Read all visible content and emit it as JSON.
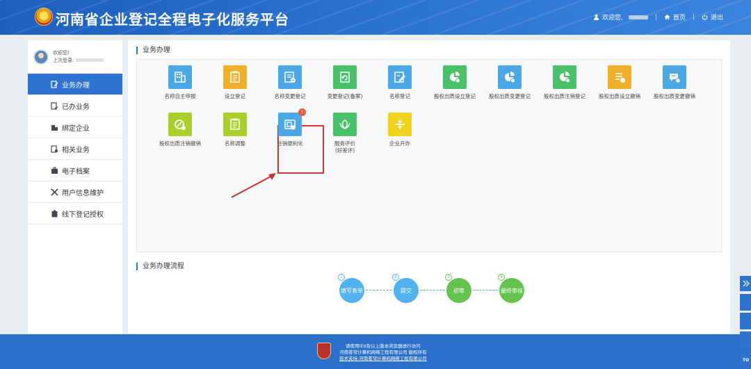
{
  "header": {
    "title": "河南省企业登记全程电子化服务平台",
    "welcome": "欢迎您,",
    "home": "首页",
    "logout": "退出"
  },
  "sidebar": {
    "welcome": "欢迎您!",
    "last_login": "上次登录:",
    "items": [
      {
        "label": "业务办理",
        "icon": "edit-doc-icon",
        "active": true
      },
      {
        "label": "已办业务",
        "icon": "done-doc-icon"
      },
      {
        "label": "绑定企业",
        "icon": "building-icon"
      },
      {
        "label": "相关业务",
        "icon": "related-doc-icon"
      },
      {
        "label": "电子档案",
        "icon": "briefcase-icon"
      },
      {
        "label": "用户信息维护",
        "icon": "tools-icon"
      },
      {
        "label": "线下登记授权",
        "icon": "badge-icon"
      }
    ]
  },
  "main": {
    "section1": "业务办理",
    "section2": "业务办理流程",
    "tiles": [
      {
        "label": "名称自主申报",
        "color": "#4ba8e5",
        "icon": "building-grid-icon"
      },
      {
        "label": "设立登记",
        "color": "#f1b02b",
        "icon": "form-icon"
      },
      {
        "label": "名称变更登记",
        "color": "#4ba8e5",
        "icon": "form-edit-icon"
      },
      {
        "label": "变更登记(备案)",
        "color": "#49c168",
        "icon": "refresh-doc-icon"
      },
      {
        "label": "名称登记",
        "color": "#4ba8e5",
        "icon": "pen-doc-icon"
      },
      {
        "label": "股权出质设立登记",
        "color": "#49c168",
        "icon": "pie-chart-icon"
      },
      {
        "label": "股权出质变更登记",
        "color": "#4ba8e5",
        "icon": "pie-chart-icon"
      },
      {
        "label": "股权出质注销登记",
        "color": "#49c168",
        "icon": "pie-chart-icon"
      },
      {
        "label": "股权出质设立撤销",
        "color": "#f1b02b",
        "icon": "list-cancel-icon"
      },
      {
        "label": "股权出质变更撤销",
        "color": "#4ba8e5",
        "icon": "chat-cancel-icon"
      },
      {
        "label": "股权出质注销撤销",
        "color": "#a9cf2a",
        "icon": "circle-cancel-icon"
      },
      {
        "label": "名称调整",
        "color": "#a9cf2a",
        "icon": "form-icon"
      },
      {
        "label": "注销便利化",
        "color": "#4ba8e5",
        "icon": "cancel-convenience-icon",
        "badge": "!"
      },
      {
        "label": "服务评价",
        "label2": "(好差评)",
        "color": "#49c168",
        "icon": "flower-icon"
      },
      {
        "label": "企业开办",
        "color": "#efd31c",
        "icon": "compress-icon"
      }
    ],
    "flow": [
      {
        "num": "1",
        "label": "填写表单",
        "color": "#52b2ee"
      },
      {
        "num": "2",
        "label": "提交",
        "color": "#52b2ee"
      },
      {
        "num": "3",
        "label": "初审",
        "color": "#64c24f"
      },
      {
        "num": "4",
        "label": "最终审核",
        "color": "#64c24f"
      }
    ]
  },
  "footer": {
    "line1": "请使用IE9及以上版本浏览器进行访问",
    "line2": "河南苍穹计算机网络工程有限公司 版权所有",
    "line3": "技术支持:河南苍穹计算机网络工程有限公司"
  },
  "float": {
    "top": "TO"
  }
}
